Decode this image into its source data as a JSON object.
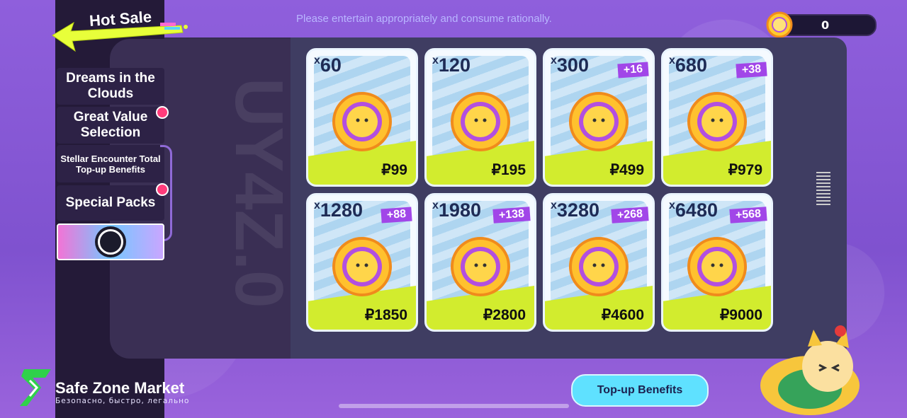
{
  "header": {
    "title": "Hot Sale",
    "notice": "Please entertain appropriately and consume rationally.",
    "balance": "0"
  },
  "sidebar": {
    "items": [
      {
        "label": "Dreams in the Clouds"
      },
      {
        "label": "Great Value Selection"
      },
      {
        "label": "Stellar Encounter Total Top-up Benefits"
      },
      {
        "label": "Special Packs"
      }
    ]
  },
  "watermark": "UY4Z.0",
  "packs": [
    {
      "qty": "60",
      "prefix": "x",
      "bonus": "",
      "price": "₽99"
    },
    {
      "qty": "120",
      "prefix": "x",
      "bonus": "",
      "price": "₽195"
    },
    {
      "qty": "300",
      "prefix": "x",
      "bonus": "+16",
      "price": "₽499"
    },
    {
      "qty": "680",
      "prefix": "x",
      "bonus": "+38",
      "price": "₽979"
    },
    {
      "qty": "1280",
      "prefix": "x",
      "bonus": "+88",
      "price": "₽1850"
    },
    {
      "qty": "1980",
      "prefix": "x",
      "bonus": "+138",
      "price": "₽2800"
    },
    {
      "qty": "3280",
      "prefix": "x",
      "bonus": "+268",
      "price": "₽4600"
    },
    {
      "qty": "6480",
      "prefix": "x",
      "bonus": "+568",
      "price": "₽9000"
    }
  ],
  "footer": {
    "top_up_label": "Top-up Benefits",
    "brand": "Safe Zone Market",
    "brand_sub": "Безопасно, быстро, легально"
  },
  "colors": {
    "accent_lime": "#d2ec2e",
    "bonus_purple": "#a146e8",
    "button_cyan": "#5fe1ff"
  }
}
